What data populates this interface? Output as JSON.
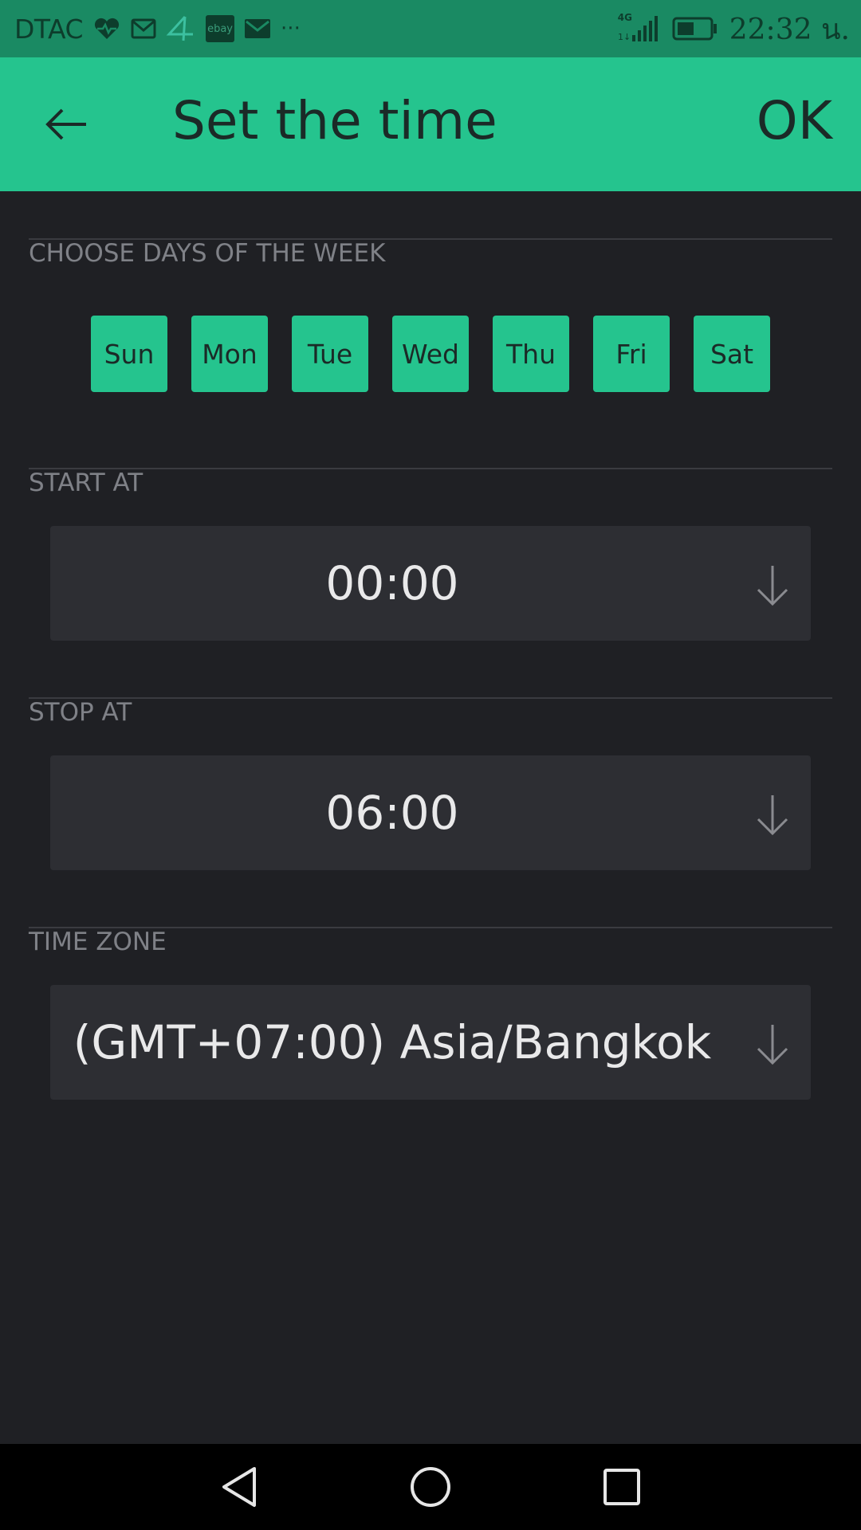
{
  "status_bar": {
    "carrier": "DTAC",
    "network": "4G",
    "time": "22:32 น.",
    "left_icons": [
      "heart-rate-icon",
      "gmail-icon",
      "number-4-icon",
      "ebay-icon",
      "mail-icon",
      "more-dots-icon"
    ],
    "ebay_label": "ebay",
    "more": "···"
  },
  "app_bar": {
    "title": "Set the time",
    "ok_label": "OK",
    "background": "#25c48e"
  },
  "days_section": {
    "label": "CHOOSE DAYS OF THE WEEK",
    "days": [
      "Sun",
      "Mon",
      "Tue",
      "Wed",
      "Thu",
      "Fri",
      "Sat"
    ]
  },
  "start_section": {
    "label": "START AT",
    "value": "00:00"
  },
  "stop_section": {
    "label": "STOP AT",
    "value": "06:00"
  },
  "timezone_section": {
    "label": "TIME ZONE",
    "value": "(GMT+07:00) Asia/Bangkok"
  },
  "nav_bar": {
    "buttons": [
      "back-triangle-icon",
      "home-circle-icon",
      "recents-square-icon"
    ]
  }
}
